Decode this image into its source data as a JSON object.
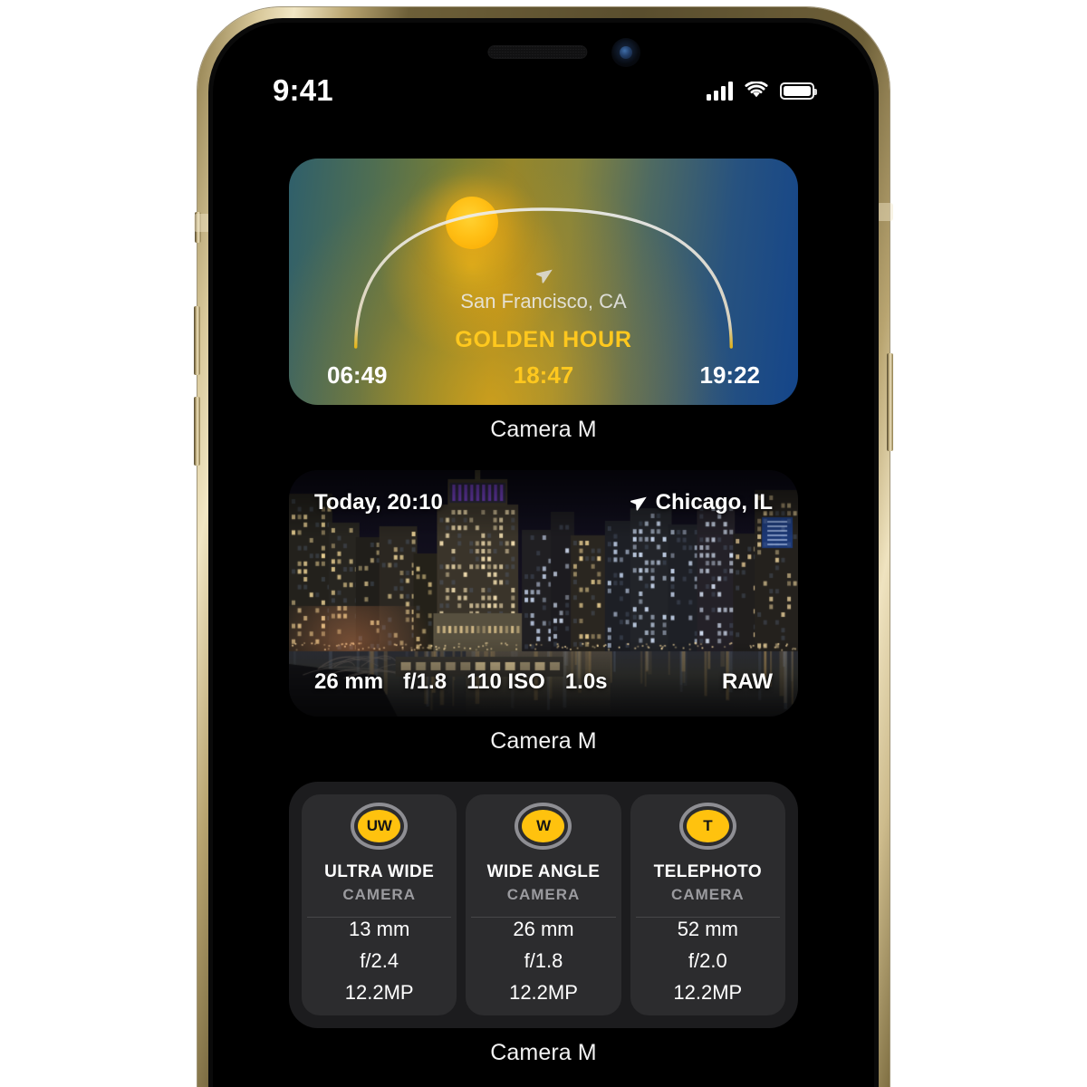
{
  "status_bar": {
    "time": "9:41",
    "signal_icon": "cellular-signal-icon",
    "wifi_icon": "wifi-icon",
    "battery_icon": "battery-full-icon"
  },
  "widgets": [
    {
      "type": "golden-hour",
      "label": "Camera M",
      "location": "San Francisco, CA",
      "location_icon": "location-arrow-icon",
      "golden_hour_title": "GOLDEN HOUR",
      "golden_hour_time": "18:47",
      "sunrise": "06:49",
      "sunset": "19:22",
      "accent_color": "#ffc81e"
    },
    {
      "type": "photo-exif",
      "label": "Camera M",
      "timestamp": "Today, 20:10",
      "location": "Chicago, IL",
      "location_icon": "location-arrow-icon",
      "exif": [
        "26 mm",
        "f/1.8",
        "110 ISO",
        "1.0s"
      ],
      "format": "RAW"
    },
    {
      "type": "lens-cards",
      "label": "Camera M",
      "cards": [
        {
          "badge": "UW",
          "name": "ULTRA WIDE",
          "subtitle": "CAMERA",
          "specs": [
            "13 mm",
            "f/2.4",
            "12.2MP"
          ]
        },
        {
          "badge": "W",
          "name": "WIDE ANGLE",
          "subtitle": "CAMERA",
          "specs": [
            "26 mm",
            "f/1.8",
            "12.2MP"
          ]
        },
        {
          "badge": "T",
          "name": "TELEPHOTO",
          "subtitle": "CAMERA",
          "specs": [
            "52 mm",
            "f/2.0",
            "12.2MP"
          ]
        }
      ],
      "badge_color": "#ffc20e"
    }
  ]
}
